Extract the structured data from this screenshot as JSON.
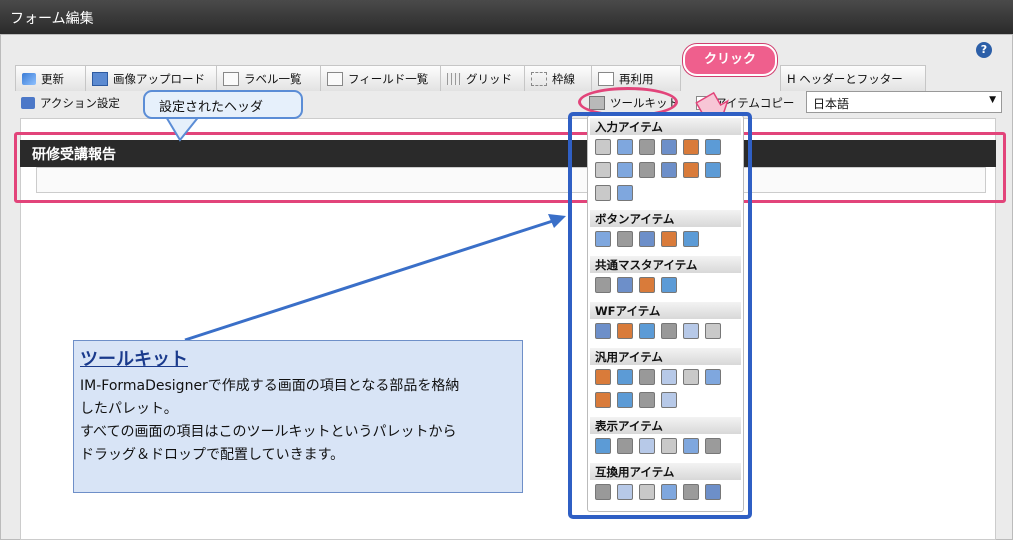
{
  "window": {
    "title": "フォーム編集"
  },
  "help_icon": "?",
  "toolbar": {
    "row1": [
      {
        "label": "更新",
        "icon": "update-icon"
      },
      {
        "label": "画像アップロード",
        "icon": "image-upload-icon"
      },
      {
        "label": "ラベル一覧",
        "icon": "label-list-icon"
      },
      {
        "label": "フィールド一覧",
        "icon": "field-list-icon"
      },
      {
        "label": "グリッド",
        "icon": "grid-icon"
      },
      {
        "label": "枠線",
        "icon": "border-icon"
      },
      {
        "label": "再利用",
        "icon": "reuse-icon"
      },
      {
        "label": "H  ヘッダーとフッター",
        "icon": "header-footer-icon"
      }
    ],
    "row2": [
      {
        "label": "アクション設定",
        "icon": "action-icon"
      },
      {
        "label": "ツールキット",
        "icon": "toolkit-icon"
      },
      {
        "label": "アイテムコピー",
        "icon": "item-copy-icon"
      }
    ],
    "language": "日本語"
  },
  "annotations": {
    "header_callout": "設定されたヘッダ",
    "click_bubble": "クリック"
  },
  "form_header": {
    "title": "研修受講報告"
  },
  "toolkit": {
    "sections": [
      {
        "title": "入力アイテム",
        "rows": [
          6,
          6,
          2
        ]
      },
      {
        "title": "ボタンアイテム",
        "rows": [
          5
        ]
      },
      {
        "title": "共通マスタアイテム",
        "rows": [
          4
        ]
      },
      {
        "title": "WFアイテム",
        "rows": [
          6
        ]
      },
      {
        "title": "汎用アイテム",
        "rows": [
          6,
          4
        ]
      },
      {
        "title": "表示アイテム",
        "rows": [
          6
        ]
      },
      {
        "title": "互換用アイテム",
        "rows": [
          6
        ]
      }
    ]
  },
  "info_box": {
    "title": "ツールキット",
    "lines": [
      "IM-FormaDesignerで作成する画面の項目となる部品を格納",
      "したパレット。",
      "すべての画面の項目はこのツールキットというパレットから",
      "ドラッグ＆ドロップで配置していきます。"
    ]
  },
  "colors": {
    "accent_pink": "#e2447a",
    "accent_blue": "#2f5fc4"
  }
}
